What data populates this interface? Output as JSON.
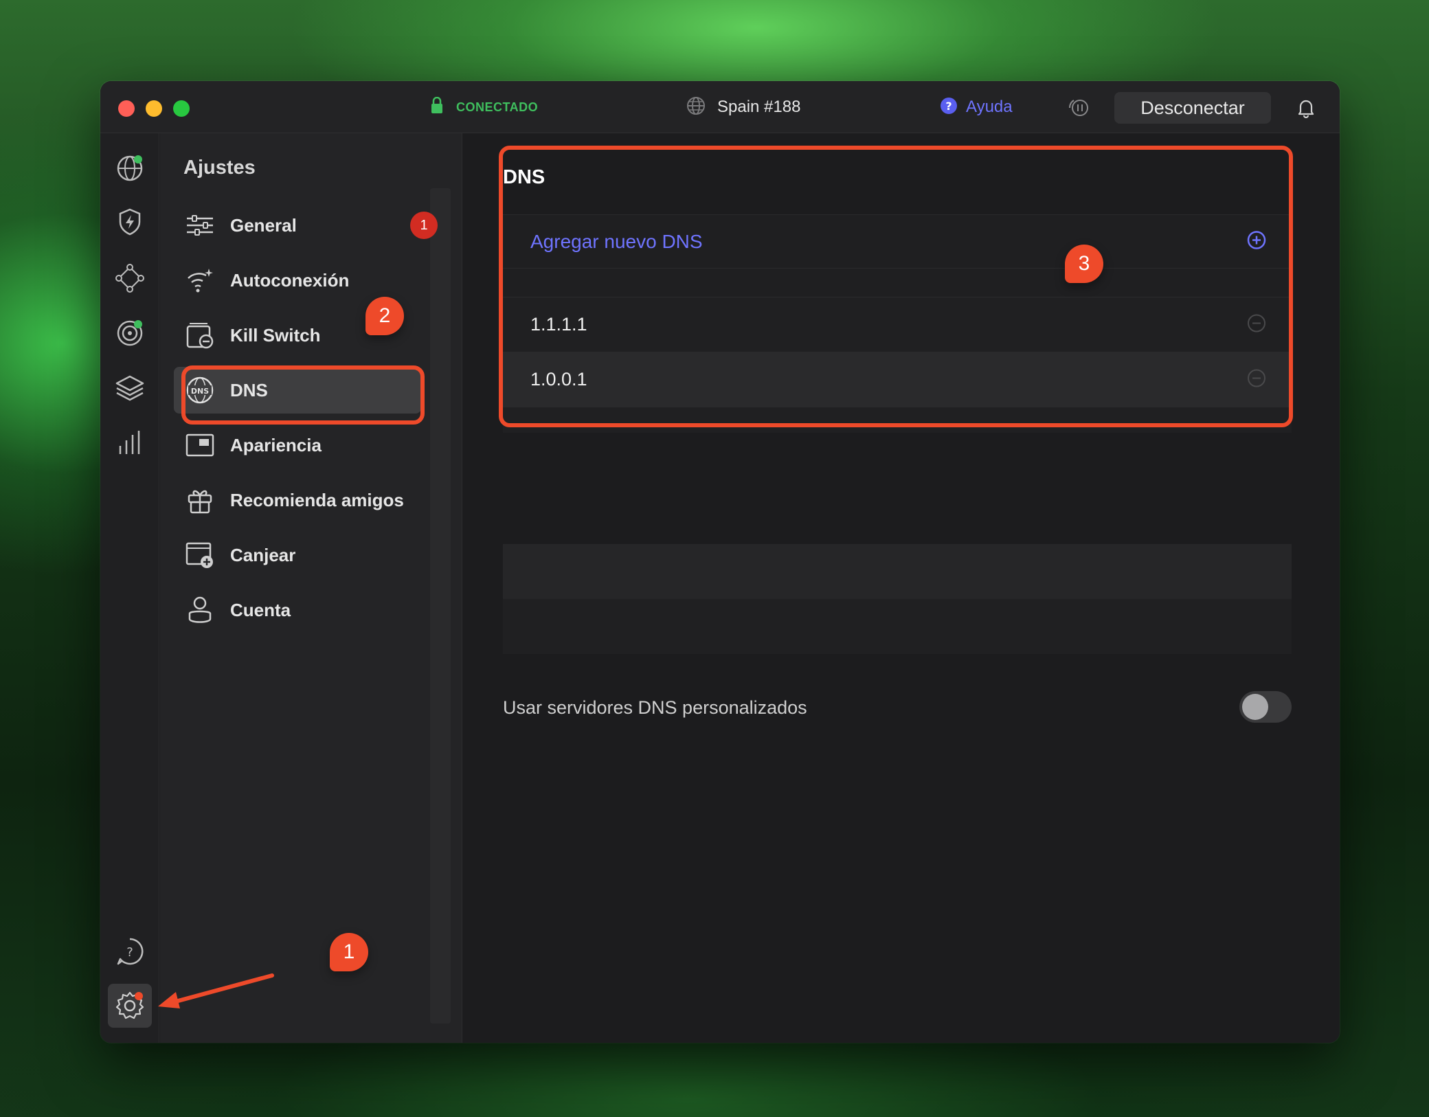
{
  "titlebar": {
    "status": "CONECTADO",
    "server": "Spain #188",
    "help": "Ayuda",
    "disconnect": "Desconectar"
  },
  "sidebar": {
    "title": "Ajustes",
    "items": [
      {
        "label": "General",
        "icon": "sliders-icon",
        "badge": "1"
      },
      {
        "label": "Autoconexión",
        "icon": "wifi-sparkle-icon"
      },
      {
        "label": "Kill Switch",
        "icon": "kill-switch-icon"
      },
      {
        "label": "DNS",
        "icon": "dns-globe-icon",
        "active": true
      },
      {
        "label": "Apariencia",
        "icon": "appearance-icon"
      },
      {
        "label": "Recomienda amigos",
        "icon": "gift-icon"
      },
      {
        "label": "Canjear",
        "icon": "redeem-icon"
      },
      {
        "label": "Cuenta",
        "icon": "account-icon"
      }
    ]
  },
  "content": {
    "title": "DNS",
    "add_label": "Agregar nuevo DNS",
    "dns_entries": [
      "1.1.1.1",
      "1.0.0.1"
    ],
    "custom_label": "Usar servidores DNS personalizados",
    "custom_enabled": false
  },
  "annotations": [
    "1",
    "2",
    "3"
  ],
  "colors": {
    "accent": "#6f74ff",
    "connected": "#3fbf5e",
    "annotation": "#ee4a2a",
    "badge": "#d22c22"
  }
}
